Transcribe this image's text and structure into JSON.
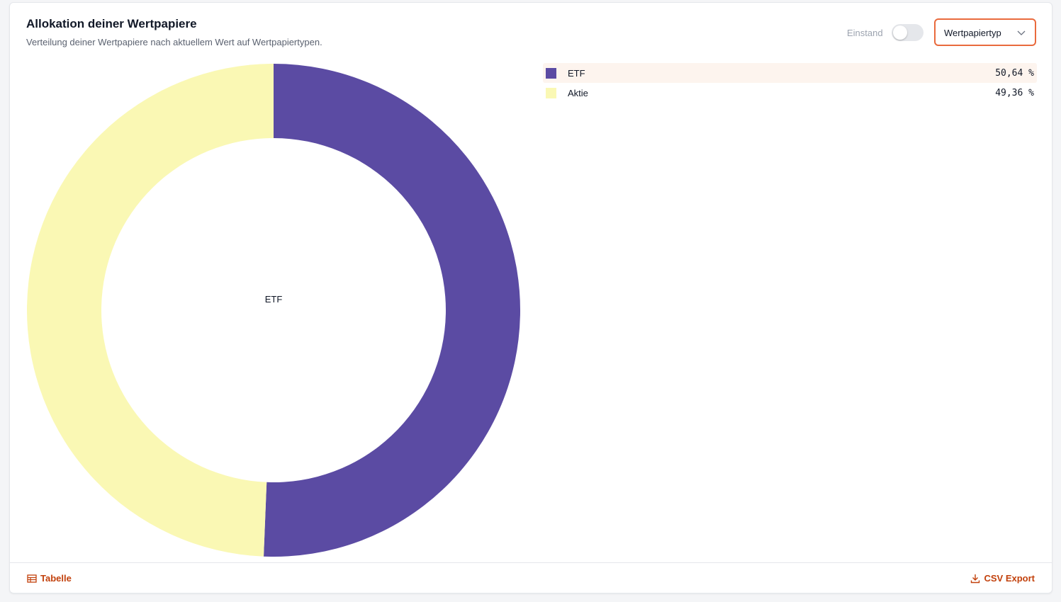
{
  "header": {
    "title": "Allokation deiner Wertpapiere",
    "subtitle": "Verteilung deiner Wertpapiere nach aktuellem Wert auf Wertpapiertypen."
  },
  "controls": {
    "toggle_label": "Einstand",
    "toggle_on": false,
    "select_value": "Wertpapiertyp",
    "chevron_icon": "chevron-down-icon"
  },
  "legend": {
    "items": [
      {
        "label": "ETF",
        "value": "50,64 %",
        "color": "#5b4ba3",
        "highlighted": true
      },
      {
        "label": "Aktie",
        "value": "49,36 %",
        "color": "#faf8b4",
        "highlighted": false
      }
    ]
  },
  "footer": {
    "table_label": "Tabelle",
    "table_icon": "table-icon",
    "export_label": "CSV Export",
    "export_icon": "download-icon"
  },
  "colors": {
    "accent": "#e96a3d",
    "link": "#c2410c",
    "etf": "#5b4ba3",
    "aktie": "#faf8b4"
  },
  "chart_data": {
    "type": "pie",
    "categories": [
      "ETF",
      "Aktie"
    ],
    "values": [
      50.64,
      49.36
    ],
    "colors": [
      "#5b4ba3",
      "#faf8b4"
    ],
    "center_label": "ETF",
    "donut": true
  }
}
